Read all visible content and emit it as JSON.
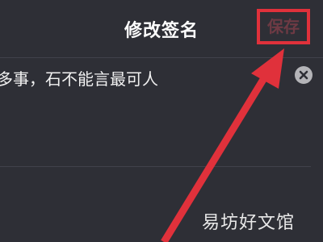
{
  "header": {
    "title": "修改签名",
    "save_label": "保存"
  },
  "signature": {
    "value": "多事，石不能言最可人"
  },
  "icons": {
    "clear": "close-circle-icon",
    "annotation": "red-arrow-icon"
  },
  "colors": {
    "background": "#2e2f36",
    "highlight": "#e0313b",
    "save_text_disabled": "#6e3a44",
    "text": "#ffffff"
  },
  "watermark": "易坊好文馆"
}
